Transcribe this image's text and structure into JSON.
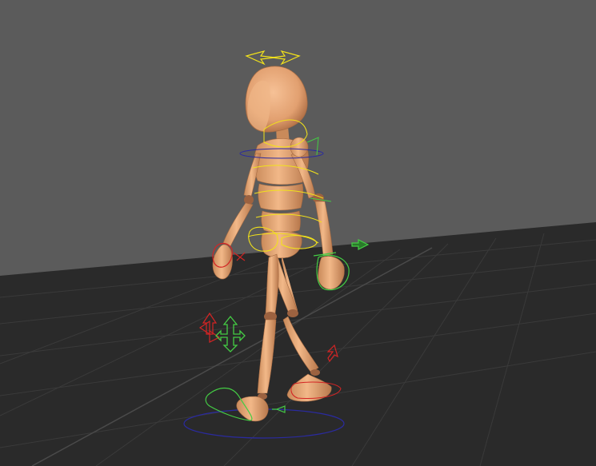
{
  "viewport": {
    "background_color": "#5b5b5b",
    "floor_color": "#2a2a2a",
    "grid_color": "#3c3c3c",
    "grid_axis_color": "#4a4a4a"
  },
  "character": {
    "skin_color": "#e6a676",
    "skin_shadow_color": "#b8784c",
    "joint_color": "#9c6240"
  },
  "rig_controls": {
    "ik_control_color": "#f2e21a",
    "fk_left_color": "#44cc44",
    "fk_right_color": "#d42424",
    "root_circle_color": "#2a2aa0",
    "controls": [
      {
        "name": "head-control-icon"
      },
      {
        "name": "spine-control-icon"
      },
      {
        "name": "hip-control-icon"
      },
      {
        "name": "left-hand-control-icon"
      },
      {
        "name": "right-hand-control-icon"
      },
      {
        "name": "left-knee-pole-icon"
      },
      {
        "name": "right-knee-pole-icon"
      },
      {
        "name": "left-foot-control-icon"
      },
      {
        "name": "right-foot-control-icon"
      },
      {
        "name": "root-control-icon"
      }
    ]
  }
}
